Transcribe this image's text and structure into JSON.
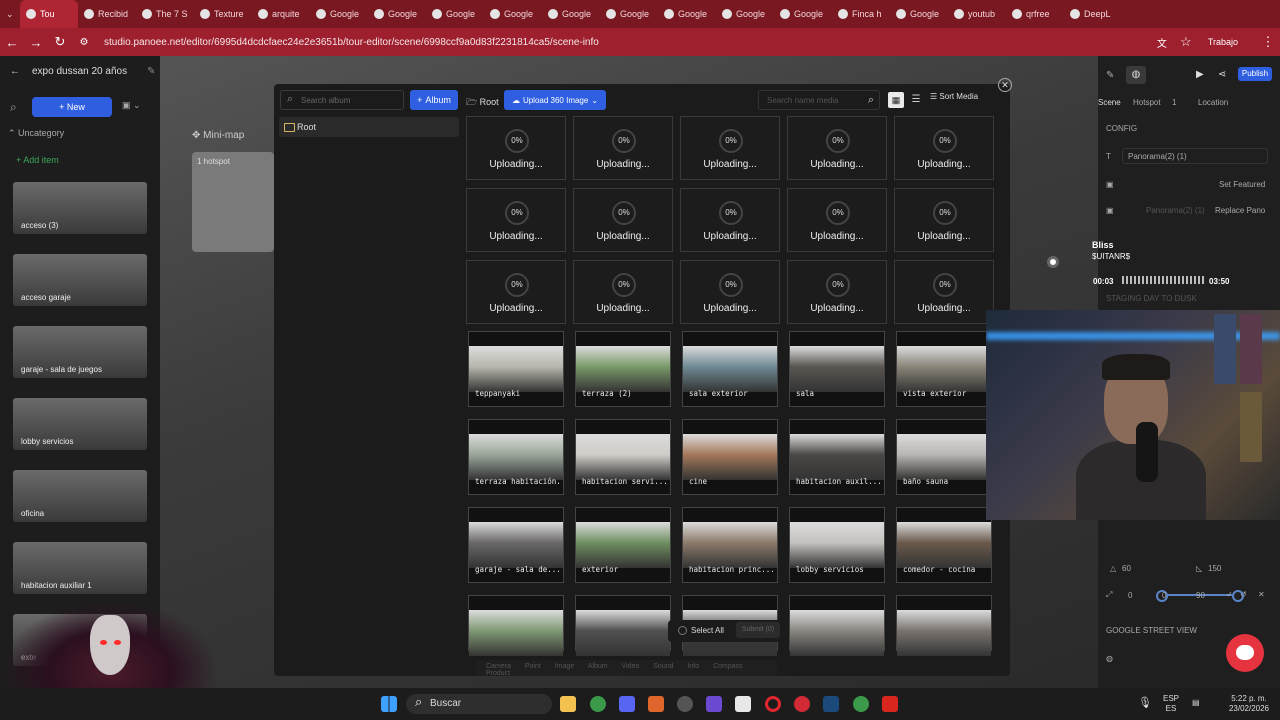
{
  "browser": {
    "tabs": [
      {
        "label": "Tou",
        "active": true
      },
      {
        "label": "Recibid"
      },
      {
        "label": "The 7 S"
      },
      {
        "label": "Texture"
      },
      {
        "label": "arquite"
      },
      {
        "label": "Google"
      },
      {
        "label": "Google"
      },
      {
        "label": "Google"
      },
      {
        "label": "Google"
      },
      {
        "label": "Google"
      },
      {
        "label": "Google"
      },
      {
        "label": "Google"
      },
      {
        "label": "Google"
      },
      {
        "label": "Google"
      },
      {
        "label": "Finca h"
      },
      {
        "label": "Google"
      },
      {
        "label": "youtub"
      },
      {
        "label": "qrfree"
      },
      {
        "label": "DeepL"
      }
    ],
    "url": "studio.panoee.net/editor/6995d4dcdcfaec24e2e3651b/tour-editor/scene/6998ccf9a0d83f2231814ca5/scene-info",
    "profile": "Trabajo"
  },
  "editor": {
    "project_title": "expo dussan 20 años",
    "new_label": "New",
    "category": "Uncategory",
    "add_item": "Add item",
    "scenes": [
      {
        "label": "acceso (3)"
      },
      {
        "label": "acceso garaje"
      },
      {
        "label": "garaje - sala de juegos"
      },
      {
        "label": "lobby servicios"
      },
      {
        "label": "oficina"
      },
      {
        "label": "habitacion auxiliar 1"
      },
      {
        "label": "exte"
      }
    ],
    "minimap_label": "Mini-map",
    "minimap_hotspot": "1 hotspot",
    "right": {
      "publish": "Publish",
      "tab_scene": "Scene",
      "tab_hotspot": "Hotspot",
      "hotspot_count": "1",
      "tab_location": "Location",
      "config": "CONFIG",
      "panorama_name": "Panorama(2) (1)",
      "set_featured": "Set Featured",
      "panorama_ref": "Panorama(2) (1)",
      "replace_pano": "Replace Pano",
      "staging": "STAGING DAY TO DUSK",
      "fov_min": "60",
      "fov_max": "150",
      "h1": "0",
      "h2": "0",
      "h3": "90",
      "street_view": "GOOGLE STREET VIEW"
    }
  },
  "media_modal": {
    "search_placeholder": "Search album",
    "album_label": "Album",
    "root_label": "Root",
    "upload_label": "Upload 360 Image",
    "media_search_placeholder": "Search name media",
    "sort_label": "Sort Media",
    "folder_label": "Root",
    "uploads": [
      {
        "pct": "0%",
        "status": "Uploading..."
      },
      {
        "pct": "0%",
        "status": "Uploading..."
      },
      {
        "pct": "0%",
        "status": "Uploading..."
      },
      {
        "pct": "0%",
        "status": "Uploading..."
      },
      {
        "pct": "0%",
        "status": "Uploading..."
      },
      {
        "pct": "0%",
        "status": "Uploading..."
      },
      {
        "pct": "0%",
        "status": "Uploading..."
      },
      {
        "pct": "0%",
        "status": "Uploading..."
      },
      {
        "pct": "0%",
        "status": "Uploading..."
      },
      {
        "pct": "0%",
        "status": "Uploading..."
      },
      {
        "pct": "0%",
        "status": "Uploading..."
      },
      {
        "pct": "0%",
        "status": "Uploading..."
      },
      {
        "pct": "0%",
        "status": "Uploading..."
      },
      {
        "pct": "0%",
        "status": "Uploading..."
      },
      {
        "pct": "0%",
        "status": "Uploading..."
      }
    ],
    "images": [
      {
        "caption": "teppanyaki",
        "color": "#b7b7ad"
      },
      {
        "caption": "terraza (2)",
        "color": "#7a9a6a"
      },
      {
        "caption": "sala exterior",
        "color": "#6f8a94"
      },
      {
        "caption": "sala",
        "color": "#5a5652"
      },
      {
        "caption": "vista exterior",
        "color": "#8a8478"
      },
      {
        "caption": "terraza habitación...",
        "color": "#9aa69a"
      },
      {
        "caption": "habitacion servi...",
        "color": "#cfcdc8"
      },
      {
        "caption": "cine",
        "color": "#a4785a"
      },
      {
        "caption": "habitacion auxil...",
        "color": "#4a4846"
      },
      {
        "caption": "baño sauna",
        "color": "#b8b6b2"
      },
      {
        "caption": "garaje - sala de...",
        "color": "#6a6868"
      },
      {
        "caption": "exterior",
        "color": "#6f8f60"
      },
      {
        "caption": "habitacion princ...",
        "color": "#8c7a6a"
      },
      {
        "caption": "lobby servicios",
        "color": "#c4c2be"
      },
      {
        "caption": "comedor - cocina",
        "color": "#6a5a4c"
      },
      {
        "caption": "",
        "color": "#7f9a74"
      },
      {
        "caption": "",
        "color": "#505050"
      },
      {
        "caption": "",
        "color": "#3a3a3a"
      },
      {
        "caption": "",
        "color": "#8a8680"
      },
      {
        "caption": "",
        "color": "#7a7470"
      }
    ],
    "select_all": "Select All",
    "submit": "Submit (0)",
    "bottom_tools": "Camera Point Image Album Video Sound Info Compass Product"
  },
  "nowplaying": {
    "artist": "Bliss",
    "track": "$UITANR$",
    "elapsed": "00:03",
    "total": "03:50"
  },
  "taskbar": {
    "search": "Buscar",
    "lang": "ESP",
    "region": "ES",
    "time": "5:22 p. m.",
    "date": "23/02/2026"
  }
}
